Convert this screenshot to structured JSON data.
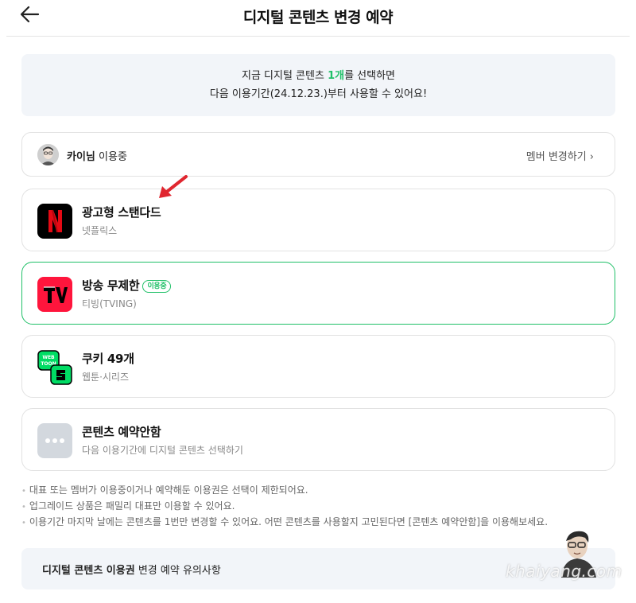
{
  "header": {
    "title": "디지털 콘텐츠 변경 예약"
  },
  "notice": {
    "line1_pre": "지금 디지털 콘텐츠 ",
    "line1_highlight": "1개",
    "line1_post": "를 선택하면",
    "line2": "다음 이용기간(24.12.23.)부터 사용할 수 있어요!"
  },
  "member": {
    "name": "카이님",
    "status": " 이용중",
    "change_label": "멤버 변경하기 ›"
  },
  "contents": [
    {
      "title": "광고형 스탠다드",
      "subtitle": "넷플릭스",
      "icon": "netflix-icon"
    },
    {
      "title": "방송 무제한",
      "subtitle": "티빙(TVING)",
      "badge": "이용중",
      "icon": "tving-icon",
      "selected": true
    },
    {
      "title": "쿠키 49개",
      "subtitle": "웹툰·시리즈",
      "icon": "webtoon-icon"
    },
    {
      "title": "콘텐츠 예약안함",
      "subtitle": "다음 이용기간에 디지털 콘텐츠 선택하기",
      "icon": "more-icon"
    }
  ],
  "notes": [
    "대표 또는 멤버가 이용중이거나 예약해둔 이용권은 선택이 제한되어요.",
    "업그레이드 상품은 패밀리 대표만 이용할 수 있어요.",
    "이용기간 마지막 날에는 콘텐츠를 1번만 변경할 수 있어요. 어떤 콘텐츠를 사용할지 고민된다면 [콘텐츠 예약안함]을 이용해보세요."
  ],
  "caution": {
    "bold": "디지털 콘텐츠 이용권",
    "rest": " 변경 예약 유의사항"
  },
  "watermark": "khaiyang.com",
  "colors": {
    "accent": "#20c068",
    "netflix_red": "#e50914",
    "tving_red": "#ff153c",
    "webtoon_green": "#00dc64"
  }
}
